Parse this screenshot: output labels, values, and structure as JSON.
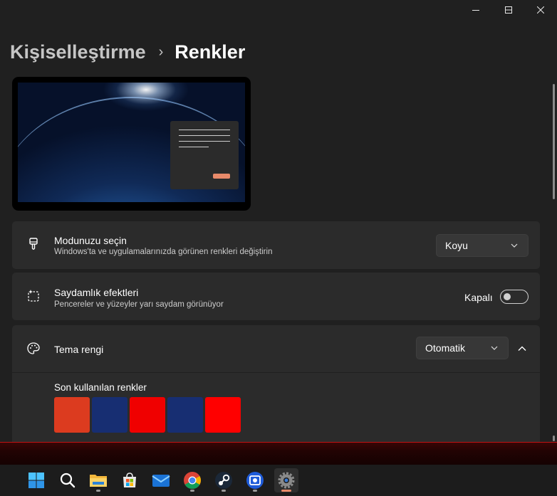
{
  "window": {
    "controls": {
      "minimize_icon": "minimize-icon",
      "maximize_icon": "maximize-icon",
      "close_icon": "close-icon"
    }
  },
  "breadcrumb": {
    "parent": "Kişiselleştirme",
    "separator": "›",
    "current": "Renkler"
  },
  "settings": {
    "mode": {
      "icon": "paintbrush-icon",
      "title": "Modunuzu seçin",
      "subtitle": "Windows'ta ve uygulamalarınızda görünen renkleri değiştirin",
      "value": "Koyu"
    },
    "transparency": {
      "icon": "transparency-effects-icon",
      "title": "Saydamlık efektleri",
      "subtitle": "Pencereler ve yüzeyler yarı saydam görünüyor",
      "state_label": "Kapalı",
      "enabled": false
    },
    "accent": {
      "icon": "palette-icon",
      "title": "Tema rengi",
      "value": "Otomatik",
      "expanded": true,
      "recent_label": "Son kullanılan renkler",
      "recent_colors": [
        "#dc3b1f",
        "#172e72",
        "#f00000",
        "#172e72",
        "#ff0000"
      ]
    }
  },
  "taskbar": {
    "items": [
      {
        "name": "start-icon"
      },
      {
        "name": "search-icon"
      },
      {
        "name": "file-explorer-icon"
      },
      {
        "name": "microsoft-store-icon"
      },
      {
        "name": "mail-icon"
      },
      {
        "name": "chrome-icon"
      },
      {
        "name": "steam-icon"
      },
      {
        "name": "photo-app-icon"
      },
      {
        "name": "settings-icon",
        "active": true
      }
    ]
  },
  "colors": {
    "accent": "#e88a6a",
    "background": "#202020",
    "card": "#2b2b2b"
  }
}
